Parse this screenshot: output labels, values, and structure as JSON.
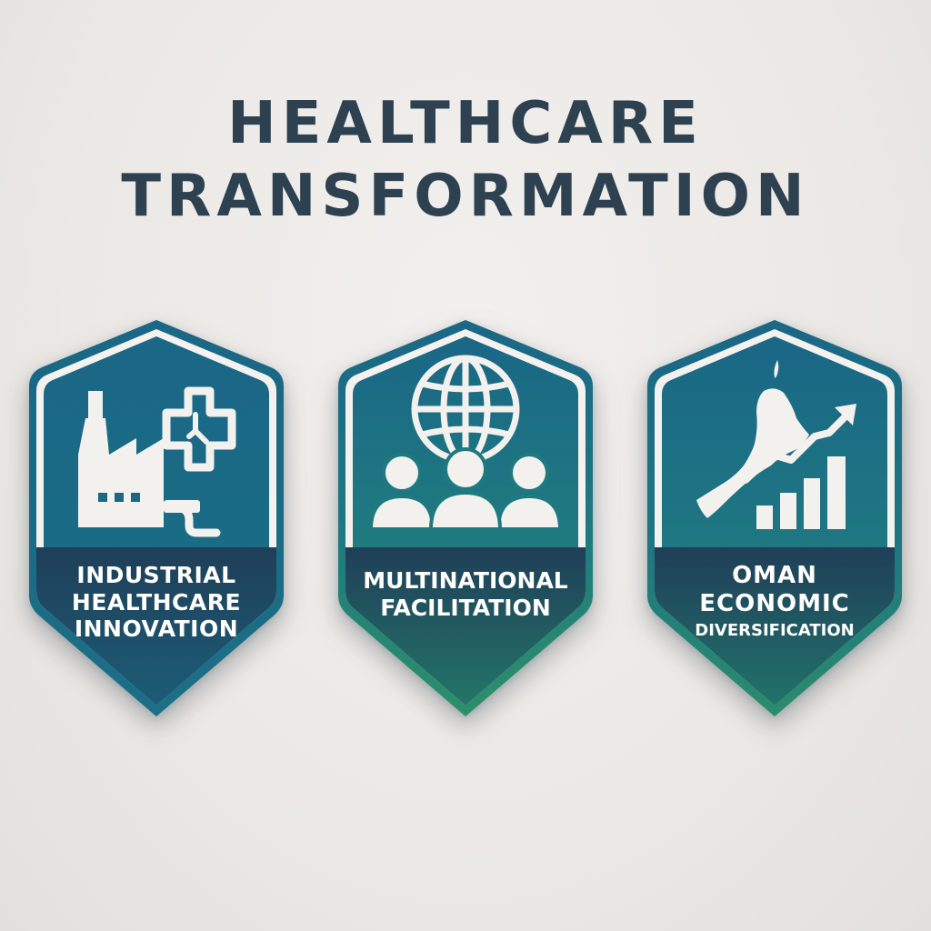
{
  "title": {
    "line1": "HEALTHCARE",
    "line2": "TRANSFORMATION"
  },
  "colors": {
    "title_text": "#2e4150",
    "badge_border": "#1f6e8c",
    "badge_teal": "#1a6a88",
    "badge_green": "#2b8f6a",
    "label_band": "#1f3d55",
    "icon_fill": "#f3f1ee"
  },
  "badges": [
    {
      "icon": "factory-medical-cross-icon",
      "label_lines": [
        "INDUSTRIAL",
        "HEALTHCARE",
        "INNOVATION"
      ]
    },
    {
      "icon": "globe-people-icon",
      "label_lines": [
        "MULTINATIONAL",
        "FACILITATION"
      ]
    },
    {
      "icon": "oman-map-growth-chart-icon",
      "label_lines": [
        "OMAN",
        "ECONOMIC",
        "DIVERSIFICATION"
      ]
    }
  ]
}
